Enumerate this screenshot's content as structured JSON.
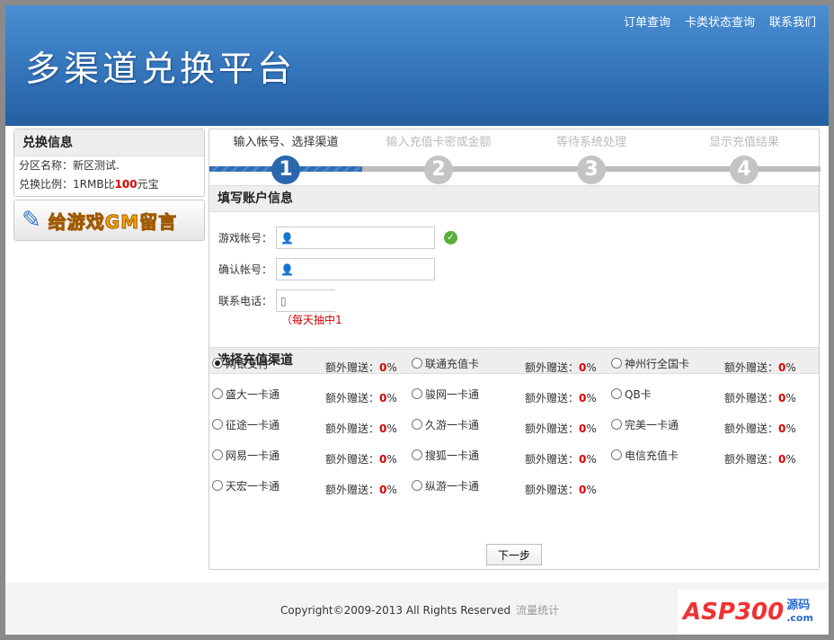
{
  "header": {
    "title": "多渠道兑换平台",
    "links": [
      "订单查询",
      "卡类状态查询",
      "联系我们"
    ]
  },
  "sidebar": {
    "title": "兑换信息",
    "zone_label": "分区名称：",
    "zone_value": "新区测试.",
    "ratio_prefix": "兑换比例：1RMB比",
    "ratio_value": "100",
    "ratio_suffix": "元宝",
    "gm_button": "给游戏GM留言"
  },
  "steps": [
    {
      "label": "输入帐号、选择渠道",
      "num": "1",
      "active": true
    },
    {
      "label": "输入充值卡密或金额",
      "num": "2"
    },
    {
      "label": "等待系统处理",
      "num": "3"
    },
    {
      "label": "显示充值结果",
      "num": "4"
    }
  ],
  "account": {
    "title": "填写账户信息",
    "game_account_label": "游戏帐号：",
    "confirm_account_label": "确认帐号：",
    "phone_label": "联系电话：",
    "note": "（每天抽中1",
    "game_account_value": "",
    "confirm_account_value": "",
    "phone_value": ""
  },
  "channels": {
    "title": "选择充值渠道",
    "bonus_label": "额外赠送：",
    "items": [
      {
        "name": "网银支付",
        "bonus": "0",
        "selected": true
      },
      {
        "name": "联通充值卡",
        "bonus": "0"
      },
      {
        "name": "神州行全国卡",
        "bonus": "0"
      },
      {
        "name": "盛大一卡通",
        "bonus": "0"
      },
      {
        "name": "骏网一卡通",
        "bonus": "0"
      },
      {
        "name": "QB卡",
        "bonus": "0"
      },
      {
        "name": "征途一卡通",
        "bonus": "0"
      },
      {
        "name": "久游一卡通",
        "bonus": "0"
      },
      {
        "name": "完美一卡通",
        "bonus": "0"
      },
      {
        "name": "网易一卡通",
        "bonus": "0"
      },
      {
        "name": "搜狐一卡通",
        "bonus": "0"
      },
      {
        "name": "电信充值卡",
        "bonus": "0"
      },
      {
        "name": "天宏一卡通",
        "bonus": "0"
      },
      {
        "name": "纵游一卡通",
        "bonus": "0"
      }
    ]
  },
  "next_button": "下一步",
  "footer": {
    "copyright": "Copyright©2009-2013 All Rights Reserved",
    "stats_link": "流量统计",
    "logo": "ASP300",
    "logo_cn": "源码",
    "logo_domain": ".com"
  }
}
